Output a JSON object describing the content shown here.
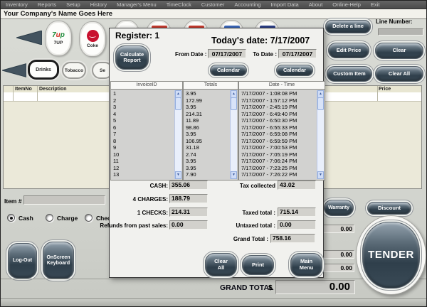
{
  "menu": {
    "items": [
      "Inventory",
      "Reports",
      "Setup",
      "History",
      "Manager's Menu",
      "TimeClock",
      "Customer",
      "Accounting",
      "Import Data",
      "About",
      "Online-Help",
      "Exit"
    ]
  },
  "titlebar": {
    "company_name": "Your Company's Name Goes Here"
  },
  "products": {
    "full": [
      {
        "label": "7UP",
        "logo_text": "7up"
      },
      {
        "label": "Coke",
        "logo": "coca-cola"
      }
    ],
    "partial_colors": [
      "#f4f4f2",
      "#c43a2e",
      "#c43a2e",
      "#3a66b8",
      "#2b3f86"
    ]
  },
  "tabs": {
    "items": [
      "Drinks",
      "Tobacco",
      "Se"
    ],
    "selected": "Drinks"
  },
  "item_table": {
    "columns": [
      "ItemNo",
      "Description",
      "Price"
    ]
  },
  "dialog": {
    "title": "Register: 1",
    "todays_date": "Today's date: 7/17/2007",
    "calculate_report": "Calculate Report",
    "from_date_label": "From Date :",
    "from_date_value": "07/17/2007",
    "to_date_label": "To Date :",
    "to_date_value": "07/17/2007",
    "calendar_button": "Calendar",
    "list_headers": [
      "InvoiceID",
      "Totals",
      "Date - Time"
    ],
    "invoice_ids": [
      "1",
      "2",
      "3",
      "4",
      "5",
      "6",
      "7",
      "8",
      "9",
      "10",
      "11",
      "12",
      "13"
    ],
    "totals": [
      "3.95",
      "172.99",
      "3.95",
      "214.31",
      "11.89",
      "98.86",
      "3.95",
      "106.95",
      "31.18",
      "2.74",
      "3.95",
      "3.95",
      "7.90"
    ],
    "date_times": [
      "7/17/2007 - 1:08:08 PM",
      "7/17/2007 - 1:57:12 PM",
      "7/17/2007 - 2:45:19 PM",
      "7/17/2007 - 6:49:40 PM",
      "7/17/2007 - 6:50:30 PM",
      "7/17/2007 - 6:55:33 PM",
      "7/17/2007 - 6:59:08 PM",
      "7/17/2007 - 6:59:59 PM",
      "7/17/2007 - 7:00:53 PM",
      "7/17/2007 - 7:05:19 PM",
      "7/17/2007 - 7:06:24 PM",
      "7/17/2007 - 7:23:25 PM",
      "7/17/2007 - 7:26:22 PM"
    ],
    "summary": {
      "cash": {
        "label": "CASH:",
        "value": "355.06"
      },
      "charges": {
        "label": "4 CHARGES:",
        "value": "188.79"
      },
      "checks": {
        "label": "1 CHECKS:",
        "value": "214.31"
      },
      "refunds": {
        "label": "Refunds from past sales:",
        "value": "0.00"
      },
      "tax_collected": {
        "label": "Tax collected",
        "value": "43.02"
      },
      "taxed_total": {
        "label": "Taxed total :",
        "value": "715.14"
      },
      "untaxed_total": {
        "label": "Untaxed total :",
        "value": "0.00"
      },
      "grand_total": {
        "label": "Grand Total :",
        "value": "758.16"
      }
    },
    "buttons": {
      "clear_all": "Clear All",
      "print": "Print",
      "main_menu": "Main Menu"
    }
  },
  "right_panel": {
    "delete_line": "Delete a line",
    "line_number_label": "Line Number:",
    "edit_price": "Edit Price",
    "clear": "Clear",
    "custom_item": "Custom Item",
    "clear_all": "Clear All"
  },
  "bottom": {
    "item_label": "Item #",
    "payment_options": [
      {
        "label": "Cash",
        "selected": true
      },
      {
        "label": "Charge",
        "selected": false
      },
      {
        "label": "Check",
        "selected": false
      }
    ],
    "logout": "Log-Out",
    "onscreen_keyboard": "OnScreen Keyboard",
    "warranty": "Warranty",
    "discount": "Discount",
    "side_values": [
      "0.00",
      "0.00",
      "0.00"
    ],
    "tender": "TENDER",
    "grand_total_label": "GRAND TOTAL",
    "currency": "$",
    "grand_total_value": "0.00"
  }
}
